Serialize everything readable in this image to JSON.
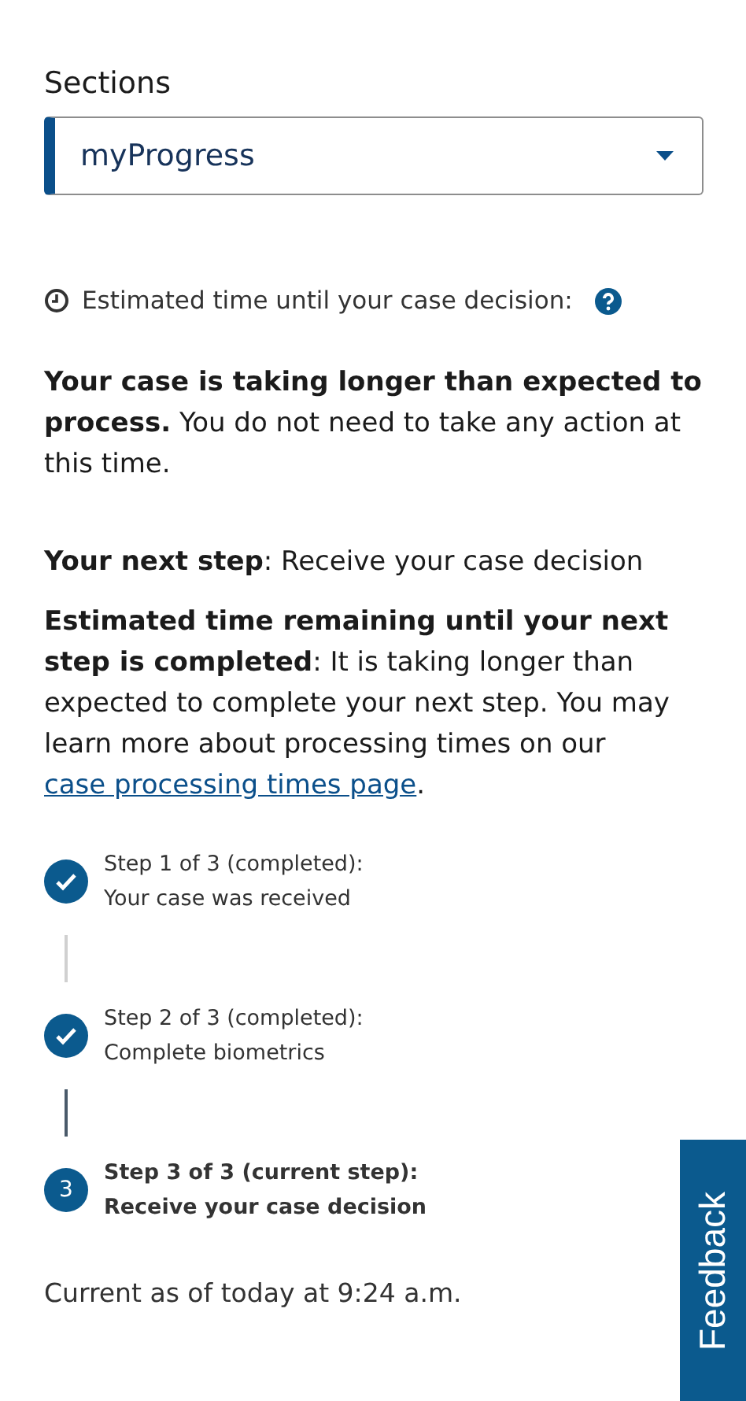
{
  "sections": {
    "label": "Sections",
    "value": "myProgress"
  },
  "estimate": {
    "label": "Estimated time until your case decision:"
  },
  "paragraphs": [
    {
      "text": "**Your case is taking longer than expected to process.** You do not need to take any action at this time."
    },
    {
      "text": "**Your next step**: Receive your case decision"
    },
    {
      "text": "**Estimated time remaining until your next step is completed**: It is taking longer than expected to complete your next step. You may learn more about processing times on our",
      "link": "case processing times page",
      "after": "."
    }
  ],
  "steps": [
    {
      "kind": "completed",
      "title": "Step 1 of 3 (completed):",
      "description": "Your case was received"
    },
    {
      "kind": "completed",
      "title": "Step 2 of 3 (completed):",
      "description": "Complete biometrics"
    },
    {
      "kind": "current",
      "number": "3",
      "title": "Step 3 of 3 (current step):",
      "description": "Receive your case decision"
    }
  ],
  "updated": "Current as of today at 9:24 a.m.",
  "feedback": "Feedback"
}
